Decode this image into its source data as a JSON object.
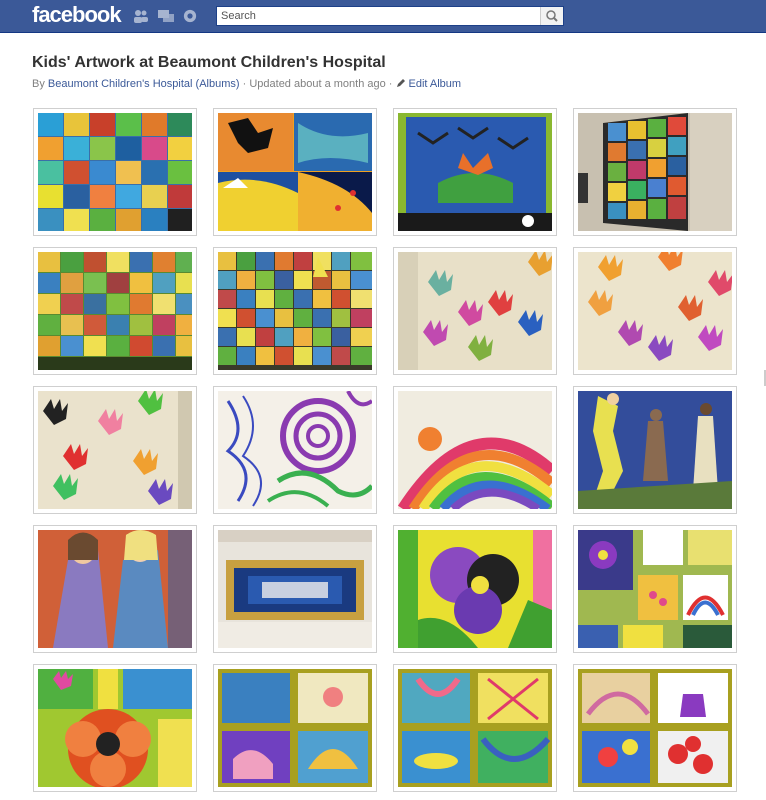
{
  "app": {
    "brand": "facebook"
  },
  "search": {
    "placeholder": "Search"
  },
  "album": {
    "title": "Kids' Artwork at Beaumont Children's Hospital",
    "by_prefix": "By ",
    "owner": "Beaumont Children's Hospital",
    "albums_link": "(Albums)",
    "updated": " · Updated about a month ago · ",
    "edit_label": "Edit Album"
  },
  "colors": {
    "brand": "#3b5998",
    "link": "#3b5998"
  },
  "icons": [
    "friends-icon",
    "messages-icon",
    "notifications-icon",
    "search-icon",
    "pencil-icon"
  ],
  "photos": [
    "photo-1",
    "photo-2",
    "photo-3",
    "photo-4",
    "photo-5",
    "photo-6",
    "photo-7",
    "photo-8",
    "photo-9",
    "photo-10",
    "photo-11",
    "photo-12",
    "photo-13",
    "photo-14",
    "photo-15",
    "photo-16",
    "photo-17",
    "photo-18",
    "photo-19",
    "photo-20"
  ]
}
